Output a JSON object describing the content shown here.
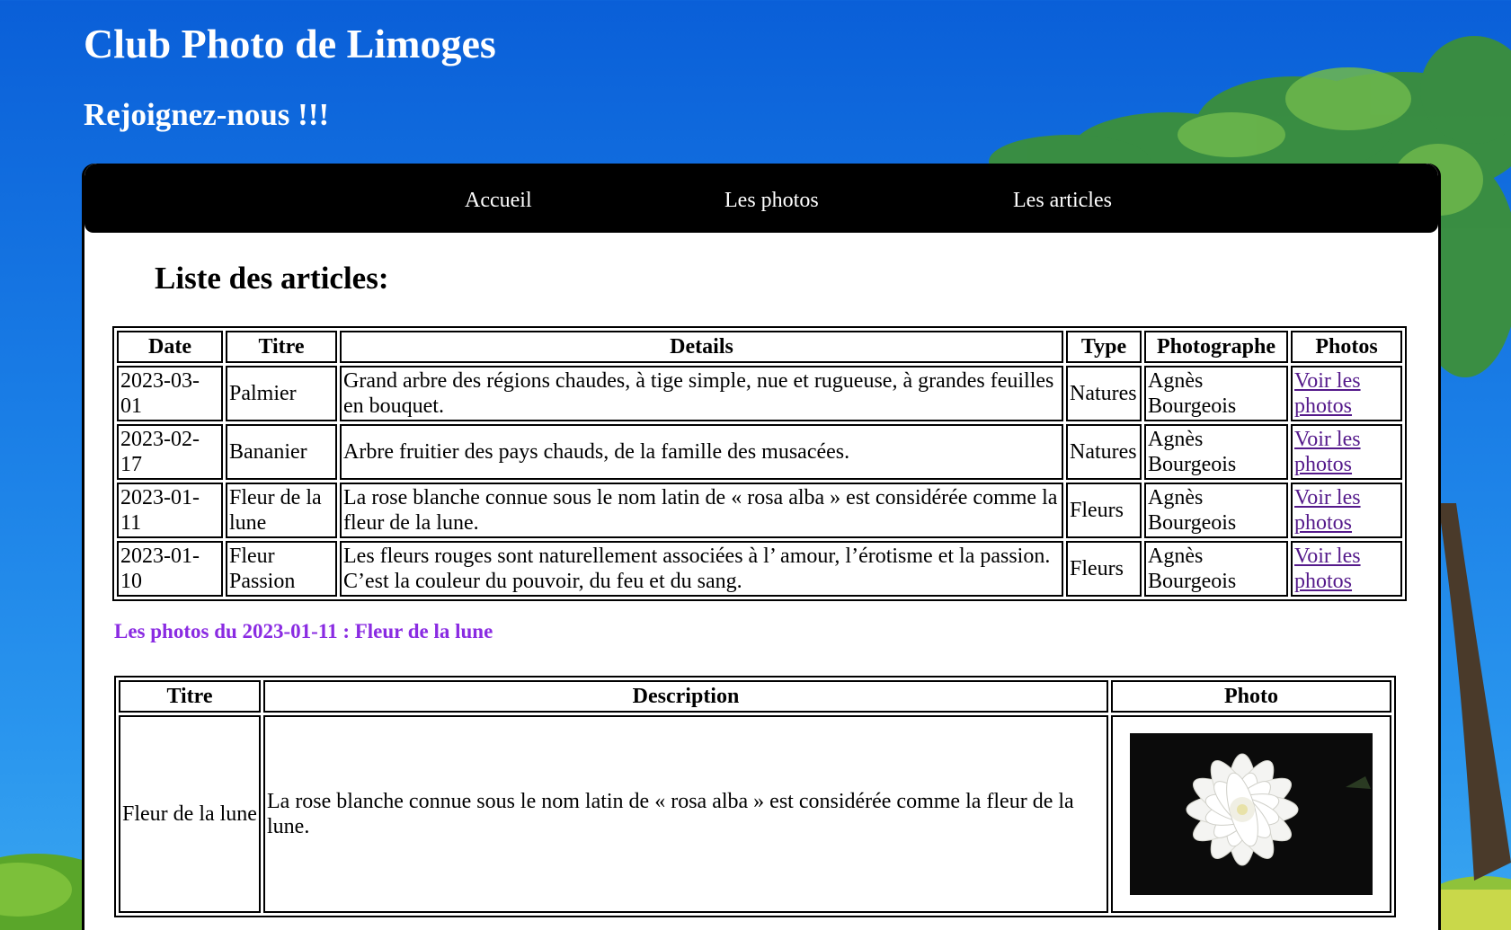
{
  "site": {
    "title": "Club Photo de Limoges",
    "subtitle": "Rejoignez-nous !!!"
  },
  "nav": {
    "items": [
      {
        "label": "Accueil"
      },
      {
        "label": "Les photos"
      },
      {
        "label": "Les articles"
      }
    ]
  },
  "articles": {
    "heading": "Liste des articles:",
    "columns": [
      "Date",
      "Titre",
      "Details",
      "Type",
      "Photographe",
      "Photos"
    ],
    "rows": [
      {
        "date": "2023-03-01",
        "titre": "Palmier",
        "details": "Grand arbre des régions chaudes, à tige simple, nue et rugueuse, à grandes feuilles en bouquet.",
        "type": "Natures",
        "photographe": "Agnès Bourgeois",
        "link": "Voir les photos"
      },
      {
        "date": "2023-02-17",
        "titre": "Bananier",
        "details": "Arbre fruitier des pays chauds, de la famille des musacées.",
        "type": "Natures",
        "photographe": "Agnès Bourgeois",
        "link": "Voir les photos"
      },
      {
        "date": "2023-01-11",
        "titre": "Fleur de la lune",
        "details": "La rose blanche connue sous le nom latin de « rosa alba » est considérée comme la fleur de la lune.",
        "type": "Fleurs",
        "photographe": "Agnès Bourgeois",
        "link": "Voir les photos"
      },
      {
        "date": "2023-01-10",
        "titre": "Fleur Passion",
        "details": "Les fleurs rouges sont naturellement associées à l’ amour, l’érotisme et la passion. C’est la couleur du pouvoir, du feu et du sang.",
        "type": "Fleurs",
        "photographe": "Agnès Bourgeois",
        "link": "Voir les photos"
      }
    ]
  },
  "photos": {
    "heading": "Les photos du 2023-01-11 : Fleur de la lune",
    "columns": [
      "Titre",
      "Description",
      "Photo"
    ],
    "rows": [
      {
        "titre": "Fleur de la lune",
        "description": "La rose blanche connue sous le nom latin de « rosa alba » est considérée comme la fleur de la lune.",
        "image": "white-flower-photo"
      }
    ]
  },
  "colors": {
    "sky": "#1a7ee6",
    "nav_bg": "#000000",
    "visited_link": "#551a8b",
    "photos_heading": "#8a2be2"
  }
}
